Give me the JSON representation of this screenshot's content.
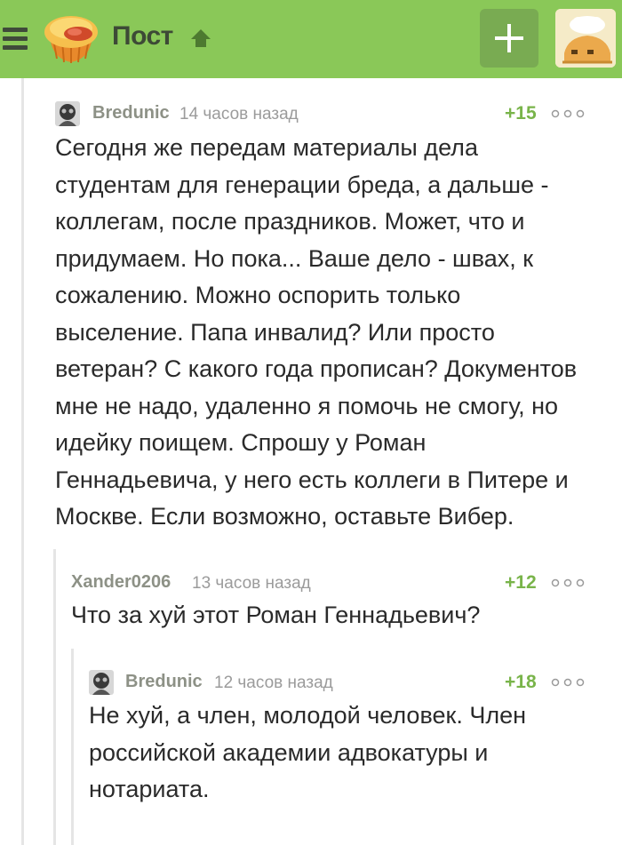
{
  "header": {
    "title": "Пост",
    "icons": {
      "menu": "hamburger-menu-icon",
      "logo": "pikabu-logo-icon",
      "scroll_up": "arrow-up-icon",
      "add": "plus-icon",
      "avatar": "user-avatar-icon"
    }
  },
  "colors": {
    "header_bg": "#8ac858",
    "rating": "#79b44a",
    "username": "#8d9186"
  },
  "comments": [
    {
      "user": "Bredunic",
      "time": "14 часов назад",
      "rating": "+15",
      "text": "Сегодня же передам материалы дела студентам для генерации бреда, а дальше - коллегам, после праздников. Может, что и придумаем. Но пока... Ваше дело - швах, к сожалению. Можно оспорить только выселение. Папа инвалид? Или просто ветеран? С какого года прописан? Документов мне не надо, удаленно я помочь не смогу, но идейку поищем. Спрошу у Роман Геннадьевича, у него есть коллеги в Питере и Москве. Если возможно, оставьте Вибер."
    },
    {
      "user": "Xander0206",
      "time": "13 часов назад",
      "rating": "+12",
      "text": "Что за хуй этот Роман Геннадьевич?"
    },
    {
      "user": "Bredunic",
      "time": "12 часов назад",
      "rating": "+18",
      "text": "Не хуй, а член, молодой человек. Член российской академии адвокатуры и нотариата."
    }
  ]
}
